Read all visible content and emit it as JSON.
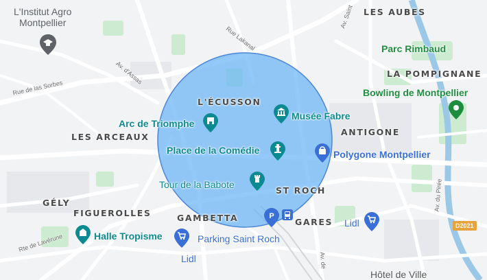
{
  "map": {
    "districts": {
      "les_aubes": "LES AUBES",
      "la_pompignane": "LA POMPIGNANE",
      "lecusson": "L'ÉCUSSON",
      "antigone": "ANTIGONE",
      "les_arceaux": "LES ARCEAUX",
      "st_roch": "ST ROCH",
      "gely": "GÉLY",
      "figuerolles": "FIGUEROLLES",
      "gambetta": "GAMBETTA",
      "gares": "GARES"
    },
    "pois": {
      "institut": "L'Institut Agro\nMontpellier",
      "parc_rimbaud": "Parc Rimbaud",
      "bowling": "Bowling de Montpellier",
      "musee_fabre": "Musée Fabre",
      "arc_triomphe": "Arc de Triomphe",
      "comedie": "Place de la Comédie",
      "polygone": "Polygone Montpellier",
      "babote": "Tour de la Babote",
      "halle_tropisme": "Halle Tropisme",
      "parking_st_roch": "Parking Saint Roch",
      "lidl_1": "Lidl",
      "lidl_2": "Lidl",
      "hotel_ville": "Hôtel de Ville"
    },
    "streets": {
      "rue_sorbes": "Rue de las Sorbes",
      "av_assas": "Av. d'Assas",
      "rue_lakanal": "Rue Lakanal",
      "av_saint": "Av. Saint",
      "rte_laverune": "Rte de Lavérune",
      "av_piree": "Av. du Pirée",
      "av_de": "Av. de"
    },
    "road_badge": "D2021",
    "icons": [
      "school-icon",
      "park-pin-icon",
      "museum-icon",
      "monument-icon",
      "shopping-bag-icon",
      "parking-icon",
      "train-station-icon",
      "cart-icon"
    ],
    "colors": {
      "radius_fill": "#69b4f5",
      "radius_stroke": "#4a86d8",
      "teal_poi": "#0b8a92",
      "blue_poi": "#3a6fd8",
      "green_poi": "#1e8e3e",
      "river": "#9cc8e8",
      "park": "#cdebd0"
    }
  }
}
